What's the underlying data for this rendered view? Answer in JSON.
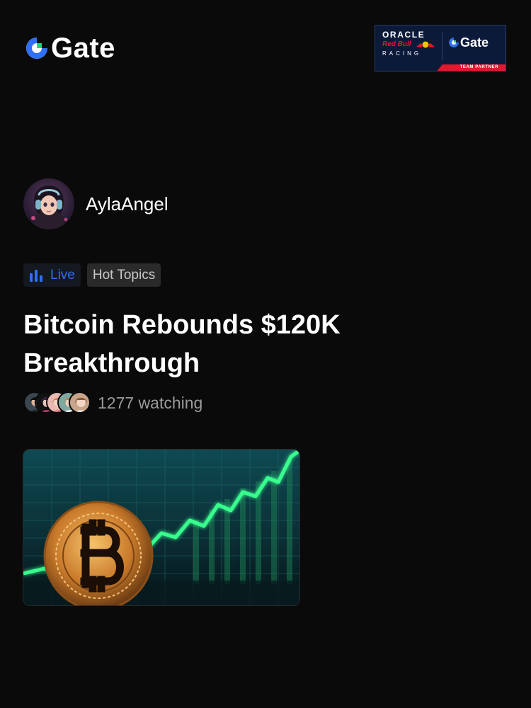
{
  "header": {
    "logo_text": "Gate",
    "logo_icon": "gate-logo-icon",
    "partner": {
      "oracle": "ORACLE",
      "redbull": "Red Bull",
      "racing": "RACING",
      "gate": "Gate",
      "badge": "TEAM PARTNER"
    }
  },
  "host": {
    "name": "AylaAngel",
    "avatar_icon": "host-avatar"
  },
  "tags": {
    "live_label": "Live",
    "live_icon": "bar-chart-icon",
    "topic_label": "Hot Topics"
  },
  "stream": {
    "title": "Bitcoin Rebounds $120K Breakthrough",
    "viewers_text": "1277 watching"
  },
  "colors": {
    "background": "#0a0a0a",
    "accent_blue": "#2f6ff5",
    "partner_navy": "#0c1a3a",
    "partner_red": "#e3172e"
  }
}
